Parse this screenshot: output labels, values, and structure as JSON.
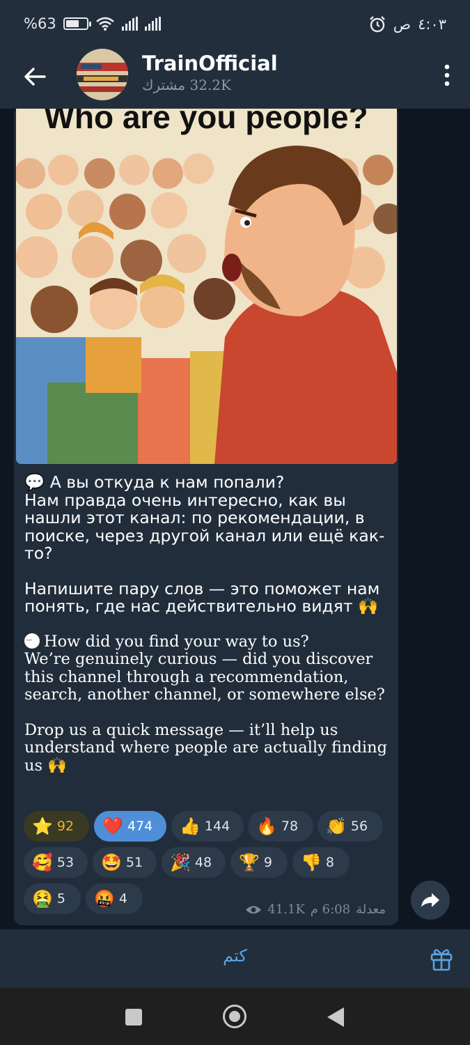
{
  "status_bar": {
    "battery": "%63",
    "battery_level": 0.63,
    "time": "٤:٠٣",
    "ampm": "ص",
    "icons": [
      "battery-icon",
      "wifi-icon",
      "signal-icon",
      "signal-icon",
      "alarm-icon"
    ]
  },
  "header": {
    "title": "TrainOfficial",
    "subscribers": "32.2K مشترك",
    "icons": [
      "back-arrow-icon",
      "more-vert-icon"
    ]
  },
  "post": {
    "image_text": "Who are you people?",
    "ru_para1": "💬 А вы откуда к нам попали?\nНам правда очень интересно, как вы нашли этот канал: по рекомендации, в поиске, через другой канал или ещё как-то?",
    "ru_para2": "Напишите пару слов — это поможет нам понять, где нас действительно видят 🙌",
    "en_para1": "How did you find your way to us?\nWe’re genuinely curious — did you discover this channel through a recommendation, search, another channel, or somewhere else?",
    "en_para2": "Drop us a quick message — it’ll help us understand where people are actually finding us 🙌",
    "reactions": [
      {
        "emoji": "⭐",
        "count": "92"
      },
      {
        "emoji": "❤️",
        "count": "474"
      },
      {
        "emoji": "👍",
        "count": "144"
      },
      {
        "emoji": "🔥",
        "count": "78"
      },
      {
        "emoji": "👏",
        "count": "56"
      },
      {
        "emoji": "🥰",
        "count": "53"
      },
      {
        "emoji": "🤩",
        "count": "51"
      },
      {
        "emoji": "🎉",
        "count": "48"
      },
      {
        "emoji": "🏆",
        "count": "9"
      },
      {
        "emoji": "👎",
        "count": "8"
      },
      {
        "emoji": "🤮",
        "count": "5"
      },
      {
        "emoji": "🤬",
        "count": "4"
      }
    ],
    "views": "41.1K",
    "time": "6:08 م",
    "edited": "معدلة"
  },
  "bottom": {
    "mute_label": "كتم",
    "icons": [
      "gift-icon",
      "share-icon"
    ]
  },
  "nav": {
    "icons": [
      "recents-icon",
      "home-icon",
      "back-icon"
    ]
  }
}
